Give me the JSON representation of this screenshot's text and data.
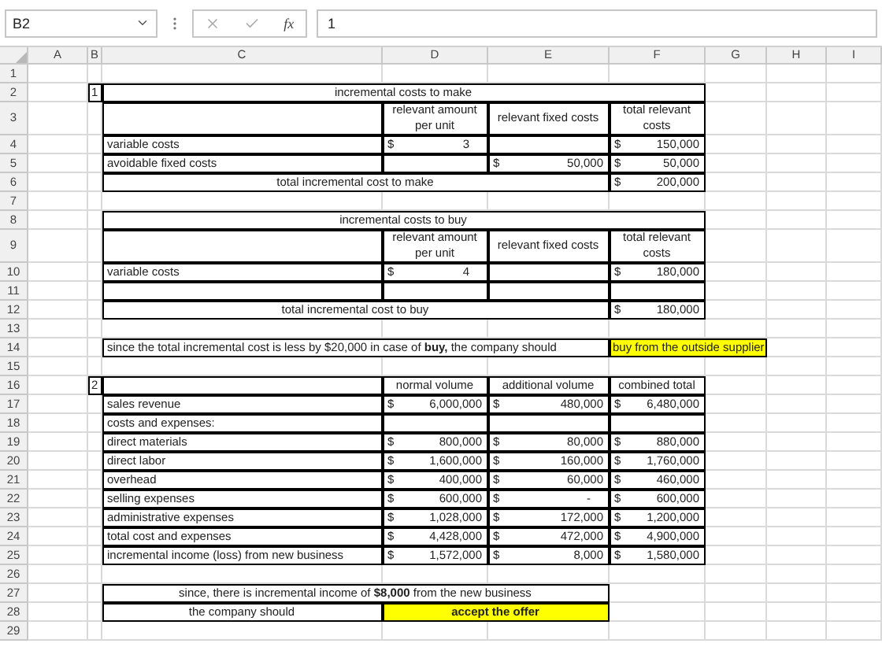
{
  "name_box": "B2",
  "function_button": "fx",
  "formula": "1",
  "columns": [
    "A",
    "B",
    "C",
    "D",
    "E",
    "F",
    "G",
    "H",
    "I"
  ],
  "rows": [
    {
      "number": "1"
    },
    {
      "number": "2",
      "B": {
        "kind": "number",
        "text": "1"
      },
      "C": {
        "kind": "heading",
        "text": "incremental costs to make"
      },
      "D": {
        "kind": "continued"
      },
      "E": {
        "kind": "continued"
      },
      "F": {
        "kind": "continued"
      }
    },
    {
      "number": "3",
      "C": {
        "kind": "blank"
      },
      "D": {
        "kind": "heading",
        "text": "relevant amount per unit"
      },
      "E": {
        "kind": "heading",
        "text": "relevant fixed costs"
      },
      "F": {
        "kind": "heading",
        "text": "total relevant costs"
      }
    },
    {
      "number": "4",
      "C": {
        "kind": "label",
        "text": "variable costs"
      },
      "D": {
        "kind": "amount",
        "currency": "$",
        "text": "3"
      },
      "E": {
        "kind": "blank"
      },
      "F": {
        "kind": "amount",
        "currency": "$",
        "text": "150,000"
      }
    },
    {
      "number": "5",
      "C": {
        "kind": "label",
        "text": "avoidable fixed costs"
      },
      "D": {
        "kind": "blank"
      },
      "E": {
        "kind": "amount",
        "currency": "$",
        "text": "50,000"
      },
      "F": {
        "kind": "amount",
        "currency": "$",
        "text": "50,000"
      }
    },
    {
      "number": "6",
      "C": {
        "kind": "heading",
        "text": "total incremental cost to make"
      },
      "D": {
        "kind": "continued"
      },
      "E": {
        "kind": "continued"
      },
      "F": {
        "kind": "amount",
        "currency": "$",
        "text": "200,000"
      }
    },
    {
      "number": "7"
    },
    {
      "number": "8",
      "C": {
        "kind": "heading",
        "text": "incremental costs to buy"
      },
      "D": {
        "kind": "continued"
      },
      "E": {
        "kind": "continued"
      },
      "F": {
        "kind": "continued"
      }
    },
    {
      "number": "9",
      "C": {
        "kind": "blank"
      },
      "D": {
        "kind": "heading",
        "text": "relevant amount per unit"
      },
      "E": {
        "kind": "heading",
        "text": "relevant fixed costs"
      },
      "F": {
        "kind": "heading",
        "text": "total relevant costs"
      }
    },
    {
      "number": "10",
      "C": {
        "kind": "label",
        "text": "variable costs"
      },
      "D": {
        "kind": "amount",
        "currency": "$",
        "text": "4"
      },
      "E": {
        "kind": "blank"
      },
      "F": {
        "kind": "amount",
        "currency": "$",
        "text": "180,000"
      }
    },
    {
      "number": "11",
      "C": {
        "kind": "blank"
      },
      "D": {
        "kind": "blank"
      },
      "E": {
        "kind": "blank"
      },
      "F": {
        "kind": "blank"
      }
    },
    {
      "number": "12",
      "C": {
        "kind": "heading",
        "text": "total incremental cost to buy"
      },
      "D": {
        "kind": "continued"
      },
      "E": {
        "kind": "continued"
      },
      "F": {
        "kind": "amount",
        "currency": "$",
        "text": "180,000"
      }
    },
    {
      "number": "13"
    },
    {
      "number": "14",
      "C": {
        "kind": "label",
        "text": "since the total incremental cost is less by $20,000 in case of **buy,** the company should"
      },
      "D": {
        "kind": "continued"
      },
      "E": {
        "kind": "continued"
      },
      "F": {
        "kind": "heading",
        "highlight": true,
        "text": "buy from the outside supplier"
      },
      "G": {
        "kind": "continued"
      }
    },
    {
      "number": "15"
    },
    {
      "number": "16",
      "B": {
        "kind": "number",
        "text": "2"
      },
      "C": {
        "kind": "blank"
      },
      "D": {
        "kind": "heading",
        "text": "normal volume"
      },
      "E": {
        "kind": "heading",
        "text": "additional volume"
      },
      "F": {
        "kind": "heading",
        "text": "combined total"
      }
    },
    {
      "number": "17",
      "C": {
        "kind": "label",
        "text": "sales revenue"
      },
      "D": {
        "kind": "amount",
        "currency": "$",
        "text": "6,000,000"
      },
      "E": {
        "kind": "amount",
        "currency": "$",
        "text": "480,000"
      },
      "F": {
        "kind": "amount",
        "currency": "$",
        "text": "6,480,000"
      }
    },
    {
      "number": "18",
      "C": {
        "kind": "label",
        "text": "costs and expenses:"
      },
      "D": {
        "kind": "blank"
      },
      "E": {
        "kind": "blank"
      },
      "F": {
        "kind": "blank"
      }
    },
    {
      "number": "19",
      "C": {
        "kind": "label",
        "text": "direct materials"
      },
      "D": {
        "kind": "amount",
        "currency": "$",
        "text": "800,000"
      },
      "E": {
        "kind": "amount",
        "currency": "$",
        "text": "80,000"
      },
      "F": {
        "kind": "amount",
        "currency": "$",
        "text": "880,000"
      }
    },
    {
      "number": "20",
      "C": {
        "kind": "label",
        "text": "direct labor"
      },
      "D": {
        "kind": "amount",
        "currency": "$",
        "text": "1,600,000"
      },
      "E": {
        "kind": "amount",
        "currency": "$",
        "text": "160,000"
      },
      "F": {
        "kind": "amount",
        "currency": "$",
        "text": "1,760,000"
      }
    },
    {
      "number": "21",
      "C": {
        "kind": "label",
        "text": "overhead"
      },
      "D": {
        "kind": "amount",
        "currency": "$",
        "text": "400,000"
      },
      "E": {
        "kind": "amount",
        "currency": "$",
        "text": "60,000"
      },
      "F": {
        "kind": "amount",
        "currency": "$",
        "text": "460,000"
      }
    },
    {
      "number": "22",
      "C": {
        "kind": "label",
        "text": "selling expenses"
      },
      "D": {
        "kind": "amount",
        "currency": "$",
        "text": "600,000"
      },
      "E": {
        "kind": "amount",
        "currency": "$",
        "text": "-"
      },
      "F": {
        "kind": "amount",
        "currency": "$",
        "text": "600,000"
      }
    },
    {
      "number": "23",
      "C": {
        "kind": "label",
        "text": "administrative expenses"
      },
      "D": {
        "kind": "amount",
        "currency": "$",
        "text": "1,028,000"
      },
      "E": {
        "kind": "amount",
        "currency": "$",
        "text": "172,000"
      },
      "F": {
        "kind": "amount",
        "currency": "$",
        "text": "1,200,000"
      }
    },
    {
      "number": "24",
      "C": {
        "kind": "label",
        "text": "total cost and expenses"
      },
      "D": {
        "kind": "amount",
        "currency": "$",
        "text": "4,428,000"
      },
      "E": {
        "kind": "amount",
        "currency": "$",
        "text": "472,000"
      },
      "F": {
        "kind": "amount",
        "currency": "$",
        "text": "4,900,000"
      }
    },
    {
      "number": "25",
      "C": {
        "kind": "label",
        "text": "incremental income (loss) from new business"
      },
      "D": {
        "kind": "amount",
        "currency": "$",
        "text": "1,572,000"
      },
      "E": {
        "kind": "amount",
        "currency": "$",
        "text": "8,000"
      },
      "F": {
        "kind": "amount",
        "currency": "$",
        "text": "1,580,000"
      }
    },
    {
      "number": "26"
    },
    {
      "number": "27",
      "C": {
        "kind": "heading",
        "text": "since, there is incremental income of **$8,000** from the new business"
      },
      "D": {
        "kind": "continued"
      },
      "E": {
        "kind": "continued"
      }
    },
    {
      "number": "28",
      "C": {
        "kind": "heading",
        "text": "the company should"
      },
      "D": {
        "kind": "heading",
        "highlight": true,
        "bold": true,
        "text": "accept the offer"
      },
      "E": {
        "kind": "continued"
      }
    },
    {
      "number": "29"
    }
  ]
}
